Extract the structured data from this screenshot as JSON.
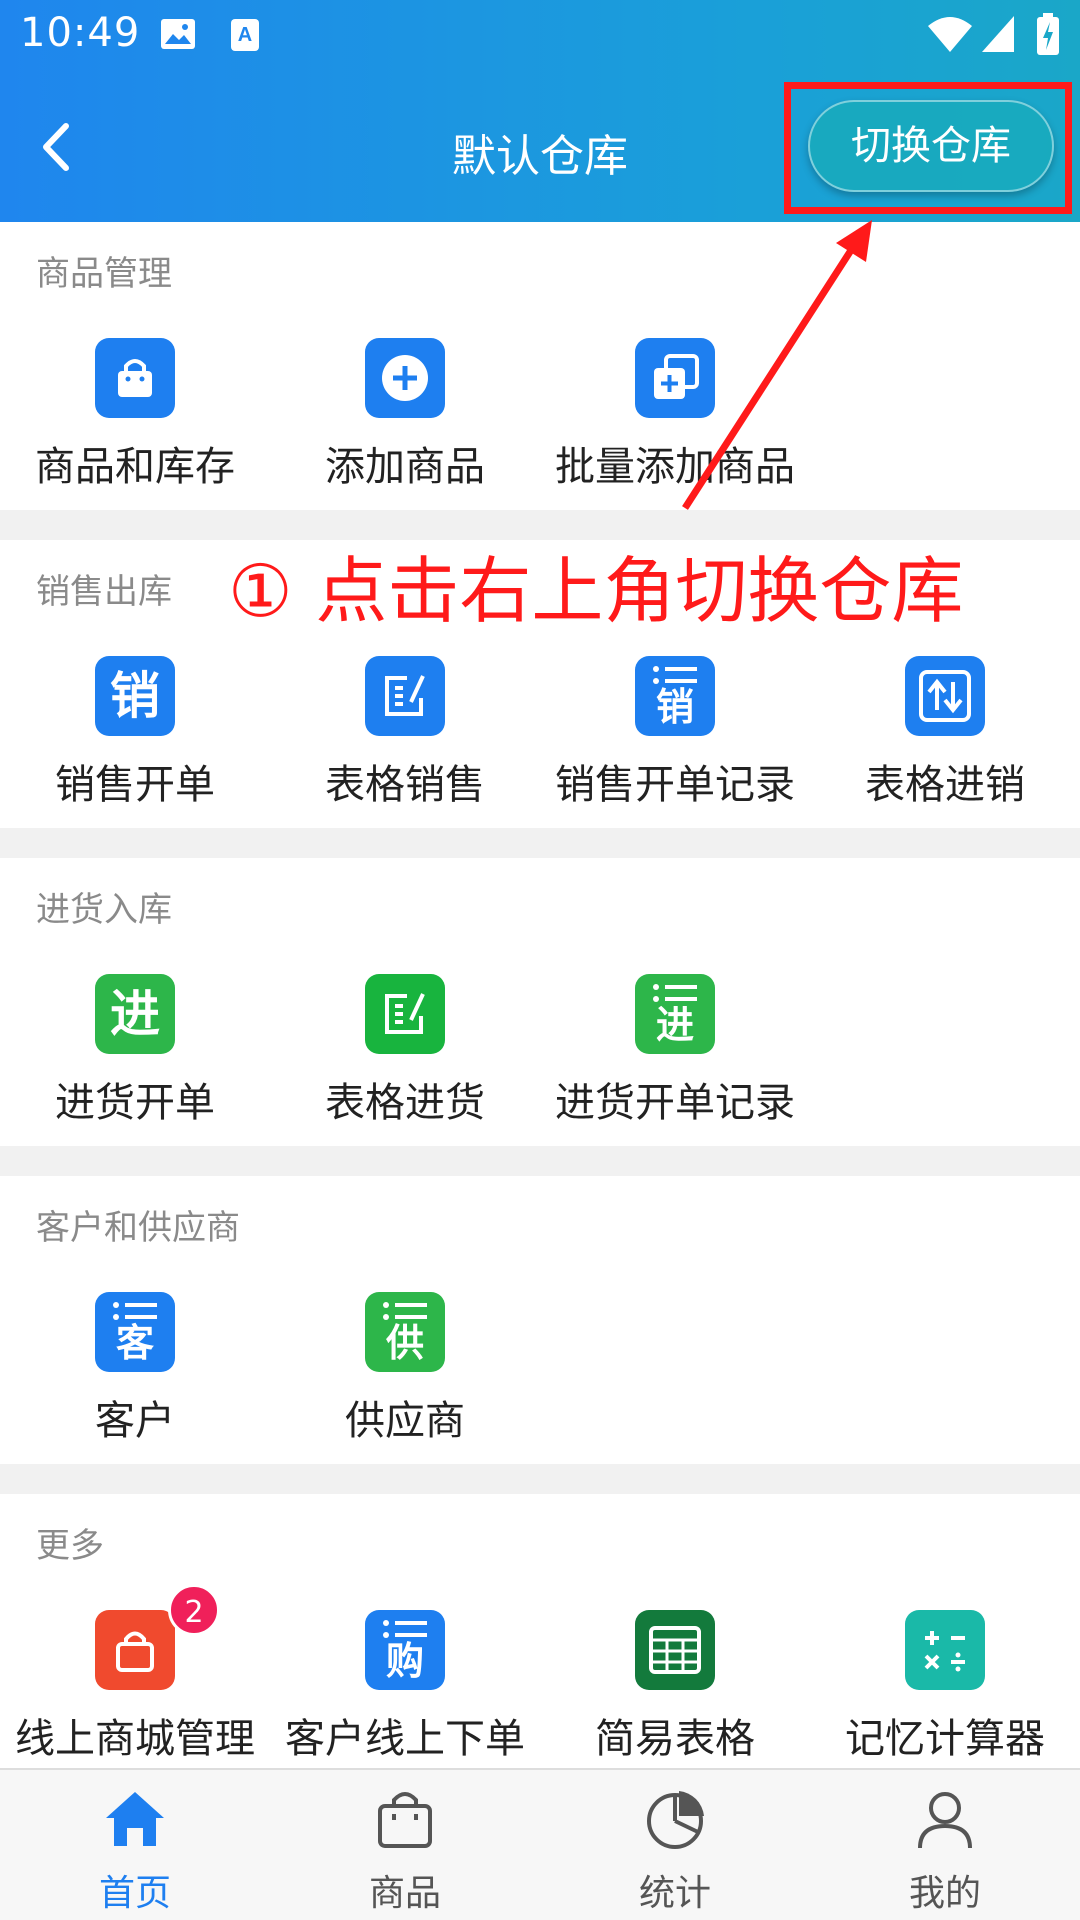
{
  "status_bar": {
    "time": "10:49"
  },
  "header": {
    "title": "默认仓库",
    "switch_button": "切换仓库"
  },
  "annotation": {
    "text": "① 点击右上角切换仓库"
  },
  "sections": {
    "goods": {
      "title": "商品管理",
      "items": [
        "商品和库存",
        "添加商品",
        "批量添加商品"
      ]
    },
    "sales": {
      "title": "销售出库",
      "items": [
        "销售开单",
        "表格销售",
        "销售开单记录",
        "表格进销"
      ],
      "icon_chars": [
        "销",
        "销"
      ]
    },
    "purchase": {
      "title": "进货入库",
      "items": [
        "进货开单",
        "表格进货",
        "进货开单记录"
      ],
      "icon_chars": [
        "进",
        "进"
      ]
    },
    "partners": {
      "title": "客户和供应商",
      "items": [
        "客户",
        "供应商"
      ],
      "icon_chars": [
        "客",
        "供"
      ]
    },
    "more": {
      "title": "更多",
      "items": [
        "线上商城管理",
        "客户线上下单",
        "简易表格",
        "记忆计算器"
      ],
      "badge": "2",
      "icon_chars": [
        "购"
      ]
    }
  },
  "bottom_nav": [
    "首页",
    "商品",
    "统计",
    "我的"
  ],
  "colors": {
    "blue": "#1e7ff0",
    "green": "#2db64a",
    "red_icon": "#f04a2e",
    "dark_green": "#137a3c",
    "teal": "#1ab9a8",
    "annotation_red": "#ff1a1a"
  }
}
